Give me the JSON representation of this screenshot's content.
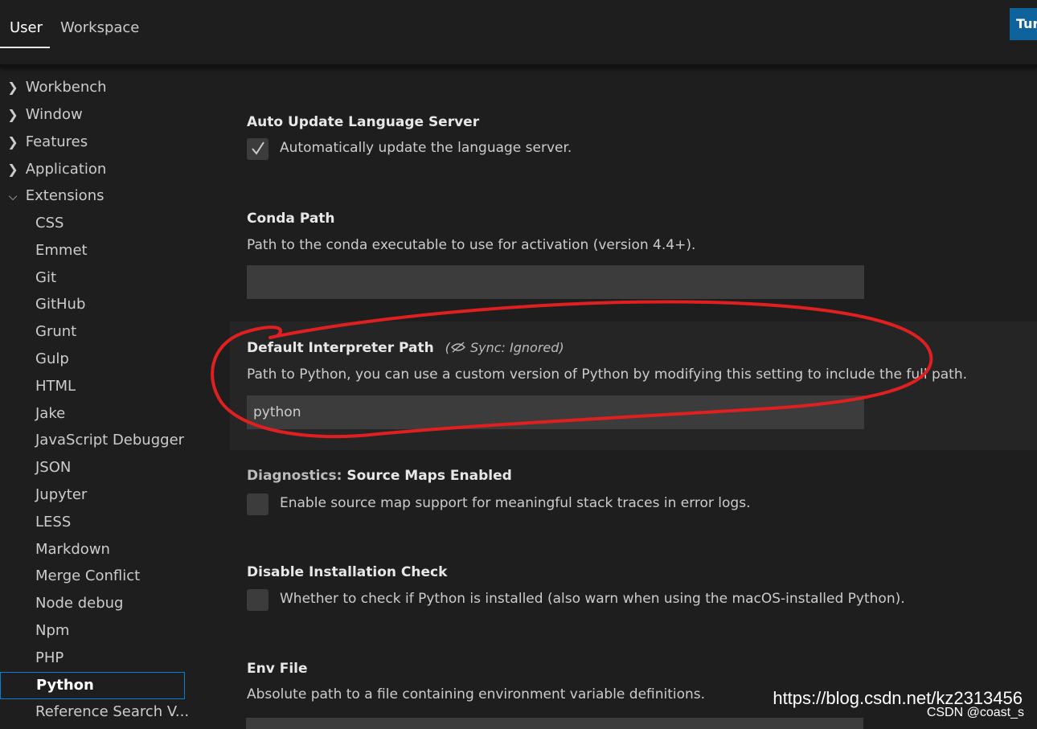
{
  "tabs": {
    "user": "User",
    "workspace": "Workspace"
  },
  "header": {
    "turn_button_label": "Turn"
  },
  "sidebar": {
    "top_items": [
      {
        "label": "Workbench",
        "expanded": false
      },
      {
        "label": "Window",
        "expanded": false
      },
      {
        "label": "Features",
        "expanded": false
      },
      {
        "label": "Application",
        "expanded": false
      },
      {
        "label": "Extensions",
        "expanded": true
      }
    ],
    "extensions_children": [
      "CSS",
      "Emmet",
      "Git",
      "GitHub",
      "Grunt",
      "Gulp",
      "HTML",
      "Jake",
      "JavaScript Debugger",
      "JSON",
      "Jupyter",
      "LESS",
      "Markdown",
      "Merge Conflict",
      "Node debug",
      "Npm",
      "PHP",
      "Python",
      "Reference Search V..."
    ],
    "selected": "Python"
  },
  "settings": {
    "auto_update": {
      "title": "Auto Update Language Server",
      "checkbox_label": "Automatically update the language server.",
      "checked": true
    },
    "conda_path": {
      "title": "Conda Path",
      "description": "Path to the conda executable to use for activation (version 4.4+).",
      "value": ""
    },
    "default_interpreter": {
      "title": "Default Interpreter Path",
      "sync_tag": "Sync: Ignored)",
      "sync_open": "(",
      "description": "Path to Python, you can use a custom version of Python by modifying this setting to include the full path.",
      "value": "python"
    },
    "diagnostics": {
      "category": "Diagnostics: ",
      "title": "Source Maps Enabled",
      "checkbox_label": "Enable source map support for meaningful stack traces in error logs.",
      "checked": false
    },
    "disable_install_check": {
      "title": "Disable Installation Check",
      "checkbox_label": "Whether to check if Python is installed (also warn when using the macOS-installed Python).",
      "checked": false
    },
    "env_file": {
      "title": "Env File",
      "description": "Absolute path to a file containing environment variable definitions."
    }
  },
  "watermark": {
    "url": "https://blog.csdn.net/kz2313456",
    "author": "CSDN @coast_s"
  },
  "colors": {
    "background": "#1e1e1e",
    "input_background": "#3c3c3c",
    "focus_border": "#007fd4",
    "accent_button": "#0e639c",
    "annotation": "#e02020"
  },
  "icons": {
    "collapsed": "chevron-right-icon",
    "expanded": "chevron-down-icon",
    "sync_ignored": "eye-off-sync-icon",
    "check": "check-icon"
  }
}
